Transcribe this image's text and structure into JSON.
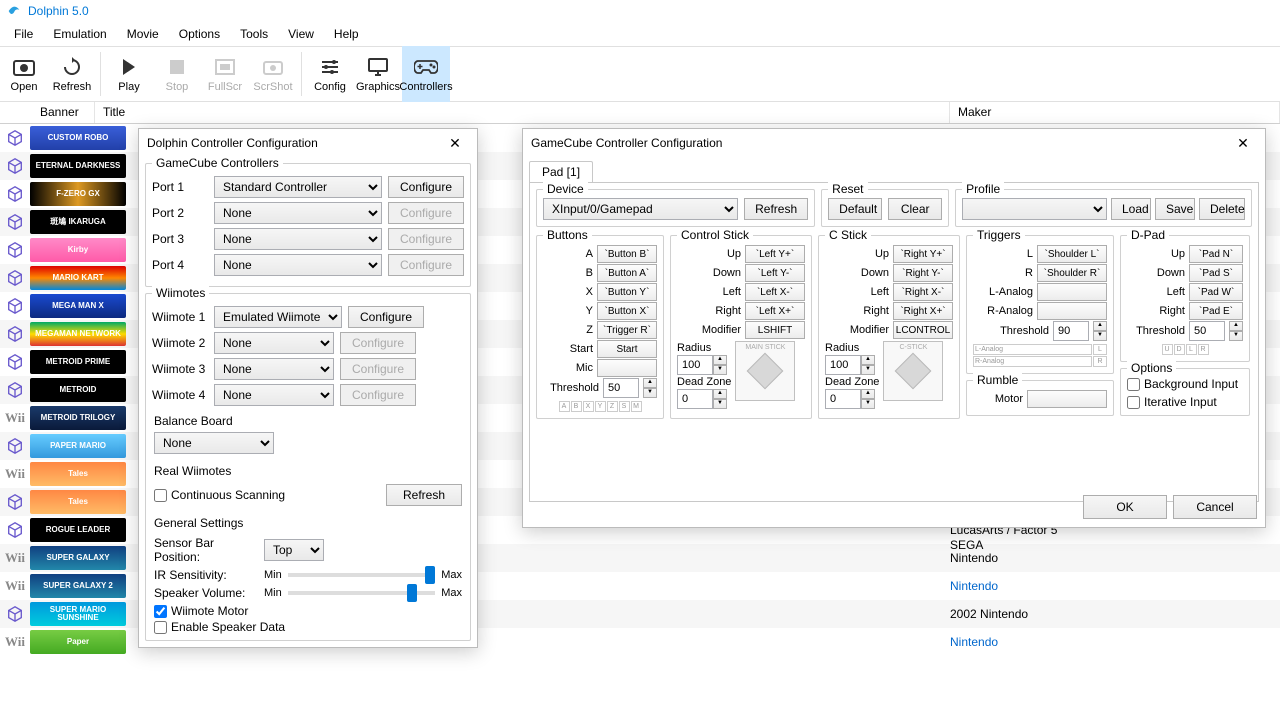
{
  "app": {
    "title": "Dolphin 5.0"
  },
  "menu": [
    "File",
    "Emulation",
    "Movie",
    "Options",
    "Tools",
    "View",
    "Help"
  ],
  "toolbar": [
    {
      "id": "open",
      "label": "Open"
    },
    {
      "id": "refresh",
      "label": "Refresh"
    },
    {
      "id": "play",
      "label": "Play"
    },
    {
      "id": "stop",
      "label": "Stop",
      "disabled": true
    },
    {
      "id": "fullscr",
      "label": "FullScr",
      "disabled": true
    },
    {
      "id": "scrshot",
      "label": "ScrShot",
      "disabled": true
    },
    {
      "id": "config",
      "label": "Config"
    },
    {
      "id": "graphics",
      "label": "Graphics"
    },
    {
      "id": "controllers",
      "label": "Controllers",
      "active": true
    }
  ],
  "cols": {
    "banner": "Banner",
    "title": "Title",
    "maker": "Maker"
  },
  "games": [
    {
      "p": "gc",
      "b": "CUSTOM ROBO",
      "bg": "linear-gradient(#3a5fd9,#2240a9)"
    },
    {
      "p": "gc",
      "b": "ETERNAL DARKNESS",
      "bg": "#000"
    },
    {
      "p": "gc",
      "b": "F-ZERO GX",
      "bg": "linear-gradient(90deg,#000,#d92,#000)"
    },
    {
      "p": "gc",
      "b": "斑鳩 IKARUGA",
      "bg": "#000"
    },
    {
      "p": "gc",
      "b": "Kirby",
      "bg": "linear-gradient(#ff8ac8,#ff5aa8)"
    },
    {
      "p": "gc",
      "b": "MARIO KART",
      "bg": "linear-gradient(#d00,#f80,#08d)"
    },
    {
      "p": "gc",
      "b": "MEGA MAN X",
      "bg": "linear-gradient(#1a4ad0,#0d2a80)"
    },
    {
      "p": "gc",
      "b": "MEGAMAN NETWORK",
      "bg": "linear-gradient(#0a6,#fd0,#d33)"
    },
    {
      "p": "gc",
      "b": "METROID PRIME",
      "bg": "#000"
    },
    {
      "p": "gc",
      "b": "METROID",
      "bg": "#000"
    },
    {
      "p": "wii",
      "b": "METROID TRILOGY",
      "bg": "linear-gradient(#1a3a6a,#0a1a3a)"
    },
    {
      "p": "gc",
      "b": "PAPER MARIO",
      "bg": "linear-gradient(#6cf,#39d)"
    },
    {
      "p": "wii",
      "b": "Tales",
      "bg": "linear-gradient(#f84,#fb6)"
    },
    {
      "p": "gc",
      "b": "Tales",
      "bg": "linear-gradient(#f84,#fb6)"
    },
    {
      "p": "gc",
      "b": "ROGUE LEADER",
      "bg": "#000",
      "maker": "LucasArts / Factor 5"
    },
    {
      "p": "wii",
      "b": "SUPER GALAXY",
      "bg": "linear-gradient(#104080,#28a)",
      "maker": "Nintendo"
    },
    {
      "p": "wii",
      "b": "SUPER GALAXY 2",
      "bg": "linear-gradient(#104080,#28a)",
      "maker": "Nintendo",
      "link": true
    },
    {
      "p": "gc",
      "b": "SUPER MARIO SUNSHINE",
      "bg": "linear-gradient(#09d,#0cd)",
      "maker": "2002  Nintendo"
    },
    {
      "p": "wii",
      "b": "Paper",
      "bg": "linear-gradient(#7c4,#4a2)",
      "maker": "Nintendo",
      "link": true
    }
  ],
  "gamesSega": "SEGA",
  "ccd": {
    "title": "Dolphin Controller Configuration",
    "gc_title": "GameCube Controllers",
    "ports": [
      {
        "label": "Port 1",
        "value": "Standard Controller",
        "cfg_enabled": true
      },
      {
        "label": "Port 2",
        "value": "None",
        "cfg_enabled": false
      },
      {
        "label": "Port 3",
        "value": "None",
        "cfg_enabled": false
      },
      {
        "label": "Port 4",
        "value": "None",
        "cfg_enabled": false
      }
    ],
    "configure": "Configure",
    "wiimotes_title": "Wiimotes",
    "wiimotes": [
      {
        "label": "Wiimote 1",
        "value": "Emulated Wiimote",
        "cfg_enabled": true
      },
      {
        "label": "Wiimote 2",
        "value": "None",
        "cfg_enabled": false
      },
      {
        "label": "Wiimote 3",
        "value": "None",
        "cfg_enabled": false
      },
      {
        "label": "Wiimote 4",
        "value": "None",
        "cfg_enabled": false
      }
    ],
    "balance_title": "Balance Board",
    "balance_value": "None",
    "real_title": "Real Wiimotes",
    "cont_scan": "Continuous Scanning",
    "refresh": "Refresh",
    "general_title": "General Settings",
    "sensor": "Sensor Bar Position:",
    "sensor_value": "Top",
    "ir": "IR Sensitivity:",
    "spk": "Speaker Volume:",
    "min": "Min",
    "max": "Max",
    "wiimote_motor": "Wiimote Motor",
    "enable_spk": "Enable Speaker Data"
  },
  "gcd": {
    "title": "GameCube Controller Configuration",
    "tab": "Pad [1]",
    "device_title": "Device",
    "device_value": "XInput/0/Gamepad",
    "refresh": "Refresh",
    "reset_title": "Reset",
    "default": "Default",
    "clear": "Clear",
    "profile_title": "Profile",
    "load": "Load",
    "save": "Save",
    "delete": "Delete",
    "buttons_title": "Buttons",
    "buttons": [
      {
        "l": "A",
        "v": "`Button B`"
      },
      {
        "l": "B",
        "v": "`Button A`"
      },
      {
        "l": "X",
        "v": "`Button Y`"
      },
      {
        "l": "Y",
        "v": "`Button X`"
      },
      {
        "l": "Z",
        "v": "`Trigger R`"
      },
      {
        "l": "Start",
        "v": "Start"
      },
      {
        "l": "Mic",
        "v": ""
      }
    ],
    "threshold_label": "Threshold",
    "threshold": "50",
    "controlstick_title": "Control Stick",
    "cs": [
      {
        "l": "Up",
        "v": "`Left Y+`"
      },
      {
        "l": "Down",
        "v": "`Left Y-`"
      },
      {
        "l": "Left",
        "v": "`Left X-`"
      },
      {
        "l": "Right",
        "v": "`Left X+`"
      },
      {
        "l": "Modifier",
        "v": "LSHIFT"
      }
    ],
    "radius_label": "Radius",
    "radius": "100",
    "dz_label": "Dead Zone",
    "dz": "0",
    "mainstick": "MAIN STICK",
    "cstick_title": "C Stick",
    "cstickL": "C-STICK",
    "ccs": [
      {
        "l": "Up",
        "v": "`Right Y+`"
      },
      {
        "l": "Down",
        "v": "`Right Y-`"
      },
      {
        "l": "Left",
        "v": "`Right X-`"
      },
      {
        "l": "Right",
        "v": "`Right X+`"
      },
      {
        "l": "Modifier",
        "v": "LCONTROL"
      }
    ],
    "triggers_title": "Triggers",
    "trg": [
      {
        "l": "L",
        "v": "`Shoulder L`"
      },
      {
        "l": "R",
        "v": "`Shoulder R`"
      },
      {
        "l": "L-Analog",
        "v": ""
      },
      {
        "l": "R-Analog",
        "v": ""
      }
    ],
    "trg_threshold": "90",
    "rumble_title": "Rumble",
    "motor": "Motor",
    "dpad_title": "D-Pad",
    "dpad": [
      {
        "l": "Up",
        "v": "`Pad N`"
      },
      {
        "l": "Down",
        "v": "`Pad S`"
      },
      {
        "l": "Left",
        "v": "`Pad W`"
      },
      {
        "l": "Right",
        "v": "`Pad E`"
      }
    ],
    "dpad_threshold": "50",
    "options_title": "Options",
    "bg_input": "Background Input",
    "it_input": "Iterative Input",
    "ok": "OK",
    "cancel": "Cancel",
    "letterrow": [
      "A",
      "B",
      "X",
      "Y",
      "Z",
      "S",
      "M"
    ],
    "trgbox": [
      "L-Analog",
      "R-Analog",
      "L",
      "R"
    ],
    "dpadbox": [
      "U",
      "D",
      "L",
      "R"
    ]
  }
}
